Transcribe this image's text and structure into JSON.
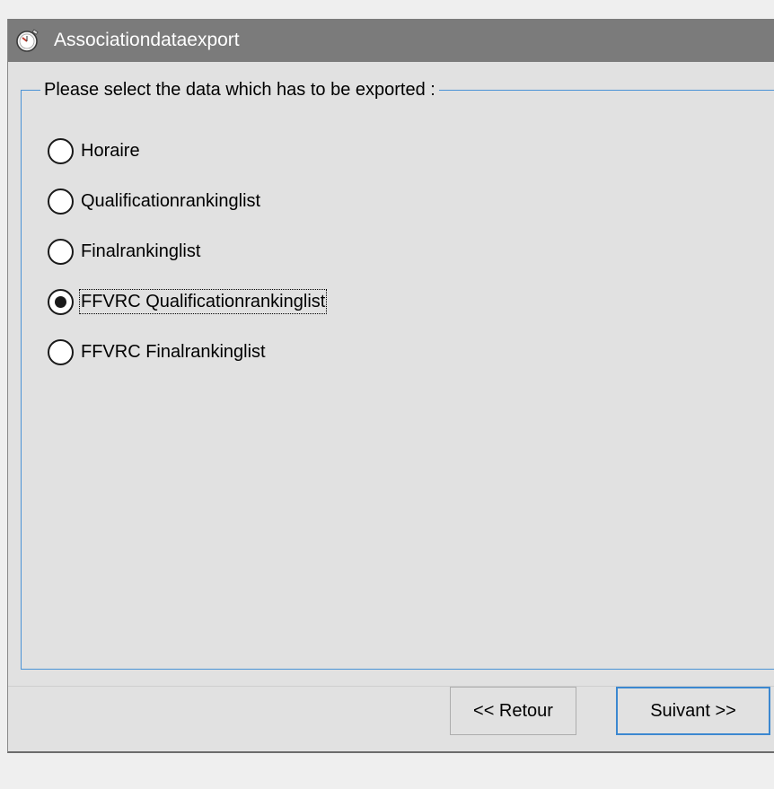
{
  "window": {
    "title": "Associationdataexport",
    "icon": "stopwatch-icon"
  },
  "group": {
    "legend": "Please select the data which has to be exported :"
  },
  "options": [
    {
      "label": "Horaire",
      "checked": false
    },
    {
      "label": "Qualificationrankinglist",
      "checked": false
    },
    {
      "label": "Finalrankinglist",
      "checked": false
    },
    {
      "label": "FFVRC Qualificationrankinglist",
      "checked": true
    },
    {
      "label": "FFVRC Finalrankinglist",
      "checked": false
    }
  ],
  "buttons": {
    "back_label": "<< Retour",
    "next_label": "Suivant >>"
  },
  "colors": {
    "titlebar": "#7b7b7b",
    "accent": "#3c88d0",
    "dialog_bg": "#e1e1e1"
  }
}
